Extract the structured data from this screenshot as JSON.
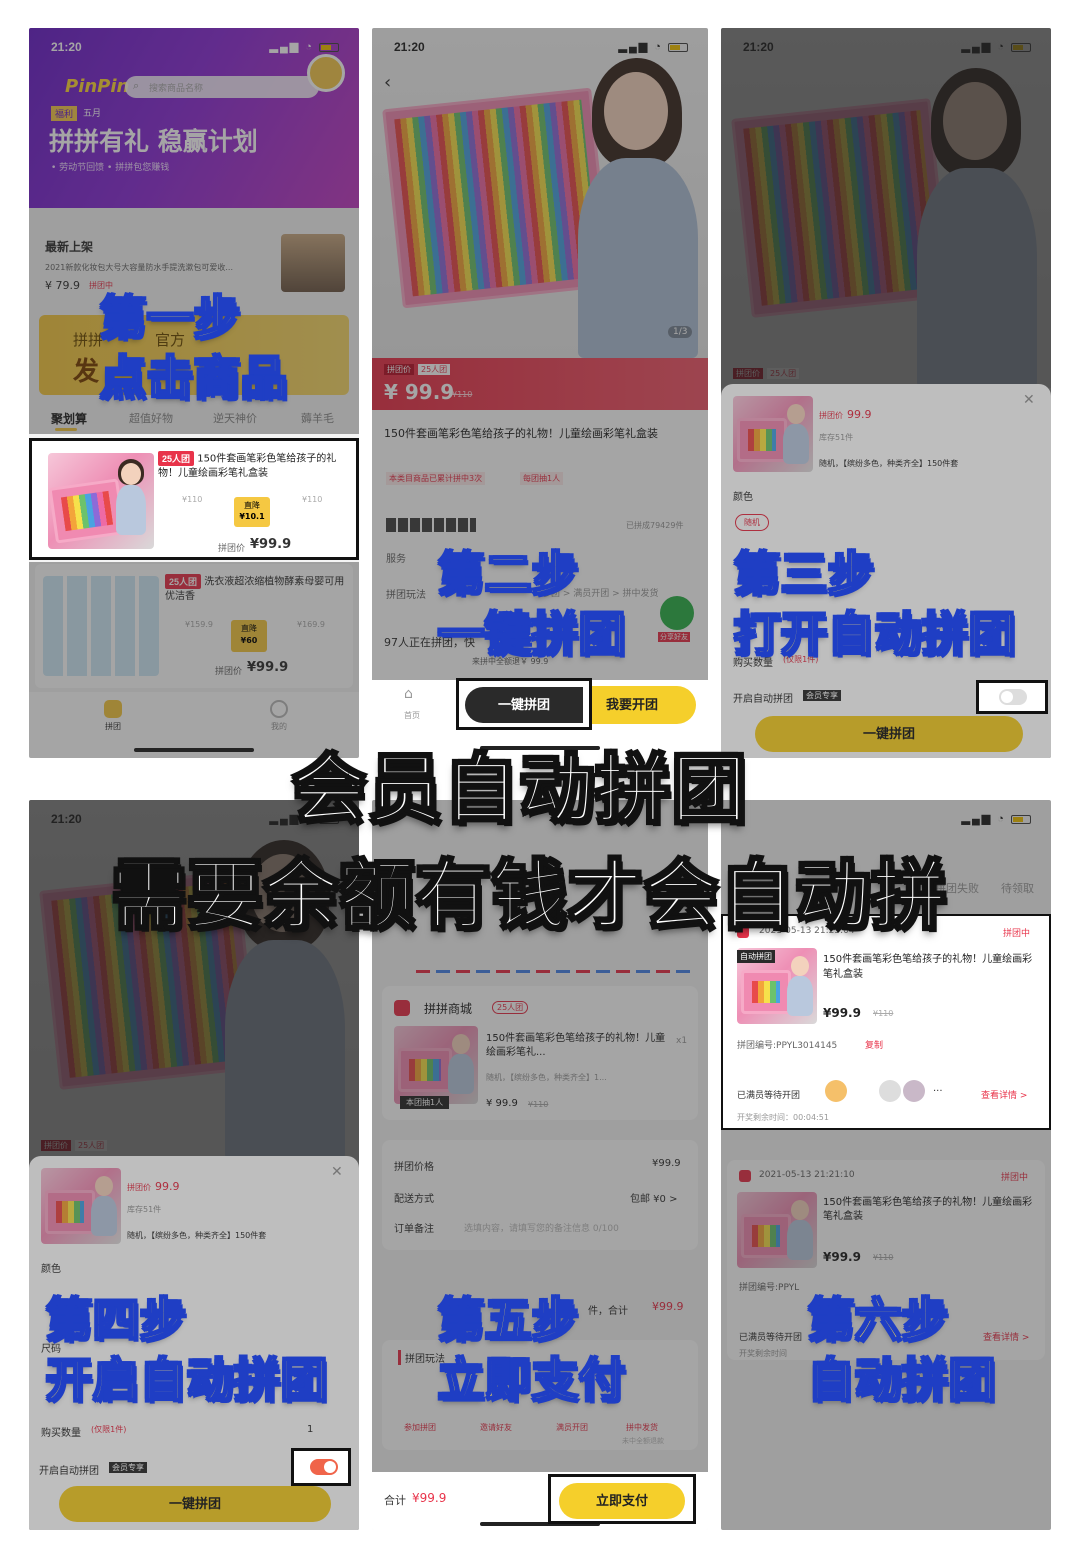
{
  "status_time": "21:20",
  "headline": {
    "line1": "会员自动拼团",
    "line2": "需要余额有钱才会自动拼"
  },
  "steps": {
    "s1a": "第一步",
    "s1b": "点击商品",
    "s2a": "第二步",
    "s2b": "一键拼团",
    "s3a": "第三步",
    "s3b": "打开自动拼团",
    "s4a": "第四步",
    "s4b": "开启自动拼团",
    "s5a": "第五步",
    "s5b": "立即支付",
    "s6a": "第六步",
    "s6b": "自动拼团"
  },
  "panel1": {
    "logo": "PinPin",
    "search_placeholder": "搜索商品名称",
    "badge": "福利",
    "month": "五月",
    "banner_title": "拼拼有礼 稳赢计划",
    "banner_sub": "• 劳动节回馈  • 拼拼包您赚钱",
    "section": "最新上架",
    "new_item": "2021新款化妆包大号大容量防水手提洗漱包可爱收...",
    "new_price": "¥ 79.9",
    "new_tag": "拼团中",
    "promo_a": "拼拼",
    "promo_b": "官方",
    "promo_c": "发",
    "tabs": [
      "聚划算",
      "超值好物",
      "逆天神价",
      "薅羊毛"
    ],
    "item1_tag": "25人团",
    "item1_title": "150件套画笔彩色笔给孩子的礼物！儿童绘画彩笔礼盒装",
    "item1_left": "¥110",
    "item1_right": "¥110",
    "item1_save": "直降",
    "item1_save_amt": "¥10.1",
    "item1_price_label": "拼团价",
    "item1_price": "¥99.9",
    "item2_tag": "25人团",
    "item2_title": "洗衣液超浓缩植物酵素母婴可用优洁香",
    "item2_left": "¥159.9",
    "item2_right": "¥169.9",
    "item2_save": "直降",
    "item2_save_amt": "¥60",
    "item2_price_label": "拼团价",
    "item2_price": "¥99.9",
    "nav": [
      "拼团",
      "我的"
    ]
  },
  "panel2": {
    "counter": "1/3",
    "label_price": "拼团价",
    "label_people": "25人团",
    "price": "¥ 99.9",
    "orig": "¥110",
    "title": "150件套画笔彩色笔给孩子的礼物！儿童绘画彩笔礼盒装",
    "note": "本类目商品已累计拼中3次",
    "note2": "每团抽1人",
    "joined": "已拼成79429件",
    "service": "服务",
    "rule": "拼团玩法",
    "rule_text": "参团 > 满员开团 > 拼中发货",
    "ongoing": "97人正在拼团，快",
    "winner": "来拼中全额退￥ 99.9",
    "share": "分享好友",
    "home": "首页",
    "btn_one": "一键拼团",
    "btn_open": "我要开团"
  },
  "panel3": {
    "label_price": "拼团价",
    "label_people": "25人团",
    "sku_price_label": "拼团价",
    "sku_price": "99.9",
    "stock": "库存51件",
    "spec": "随机，【缤纷多色，种类齐全】150件套",
    "color": "颜色",
    "color_opt": "随机",
    "qty": "购买数量",
    "qty_limit": "(仅限1件)",
    "auto": "开启自动拼团",
    "auto_tag": "会员专享",
    "btn": "一键拼团"
  },
  "panel4": {
    "label_price": "拼团价",
    "label_people": "25人团",
    "sku_price_label": "拼团价",
    "sku_price": "99.9",
    "stock": "库存51件",
    "spec": "随机，【缤纷多色，种类齐全】150件套",
    "color": "颜色",
    "size": "尺码",
    "qty": "购买数量",
    "qty_limit": "(仅限1件)",
    "qty_val": "1",
    "auto": "开启自动拼团",
    "auto_tag": "会员专享",
    "btn": "一键拼团"
  },
  "panel5": {
    "shop": "拼拼商城",
    "shop_tag": "25人团",
    "title": "150件套画笔彩色笔给孩子的礼物！儿童绘画彩笔礼...",
    "spec": "随机，【缤纷多色，种类齐全】1...",
    "qty": "x1",
    "img_tag": "本团抽1人",
    "price": "¥ 99.9",
    "orig": "¥110",
    "row1_l": "拼团价格",
    "row1_r": "¥99.9",
    "row2_l": "配送方式",
    "row2_r": "包邮 ¥0 >",
    "row3_l": "订单备注",
    "row3_r": "选填内容，请填写您的备注信息 0/100",
    "count": "件，合计",
    "count_amt": "¥99.9",
    "rule": "拼团玩法",
    "flow": [
      "参加拼团",
      "邀请好友",
      "满员开团",
      "拼中发货"
    ],
    "flow_sub": "未中全额退款",
    "total_label": "合计",
    "total": "¥99.9",
    "btn": "立即支付"
  },
  "panel6": {
    "tabs": [
      "拼团失败",
      "待领取"
    ],
    "o1_time": "2021-05-13 21:25:04",
    "o1_status": "拼团中",
    "o1_tag": "自动拼团",
    "o1_title": "150件套画笔彩色笔给孩子的礼物！儿童绘画彩笔礼盒装",
    "o1_price": "¥99.9",
    "o1_orig": "¥110",
    "o1_no": "拼团编号:PPYL3014145",
    "o1_copy": "复制",
    "o1_wait": "已满员等待开团",
    "o1_more": "···",
    "o1_detail": "查看详情 >",
    "o1_remain": "开奖剩余时间：00:04:51",
    "o2_time": "2021-05-13 21:21:10",
    "o2_status": "拼团中",
    "o2_title": "150件套画笔彩色笔给孩子的礼物！儿童绘画彩笔礼盒装",
    "o2_price": "¥99.9",
    "o2_orig": "¥110",
    "o2_no": "拼团编号:PPYL",
    "o2_wait": "已满员等待开团",
    "o2_detail": "查看详情 >",
    "o2_remain": "开奖剩余时间"
  }
}
